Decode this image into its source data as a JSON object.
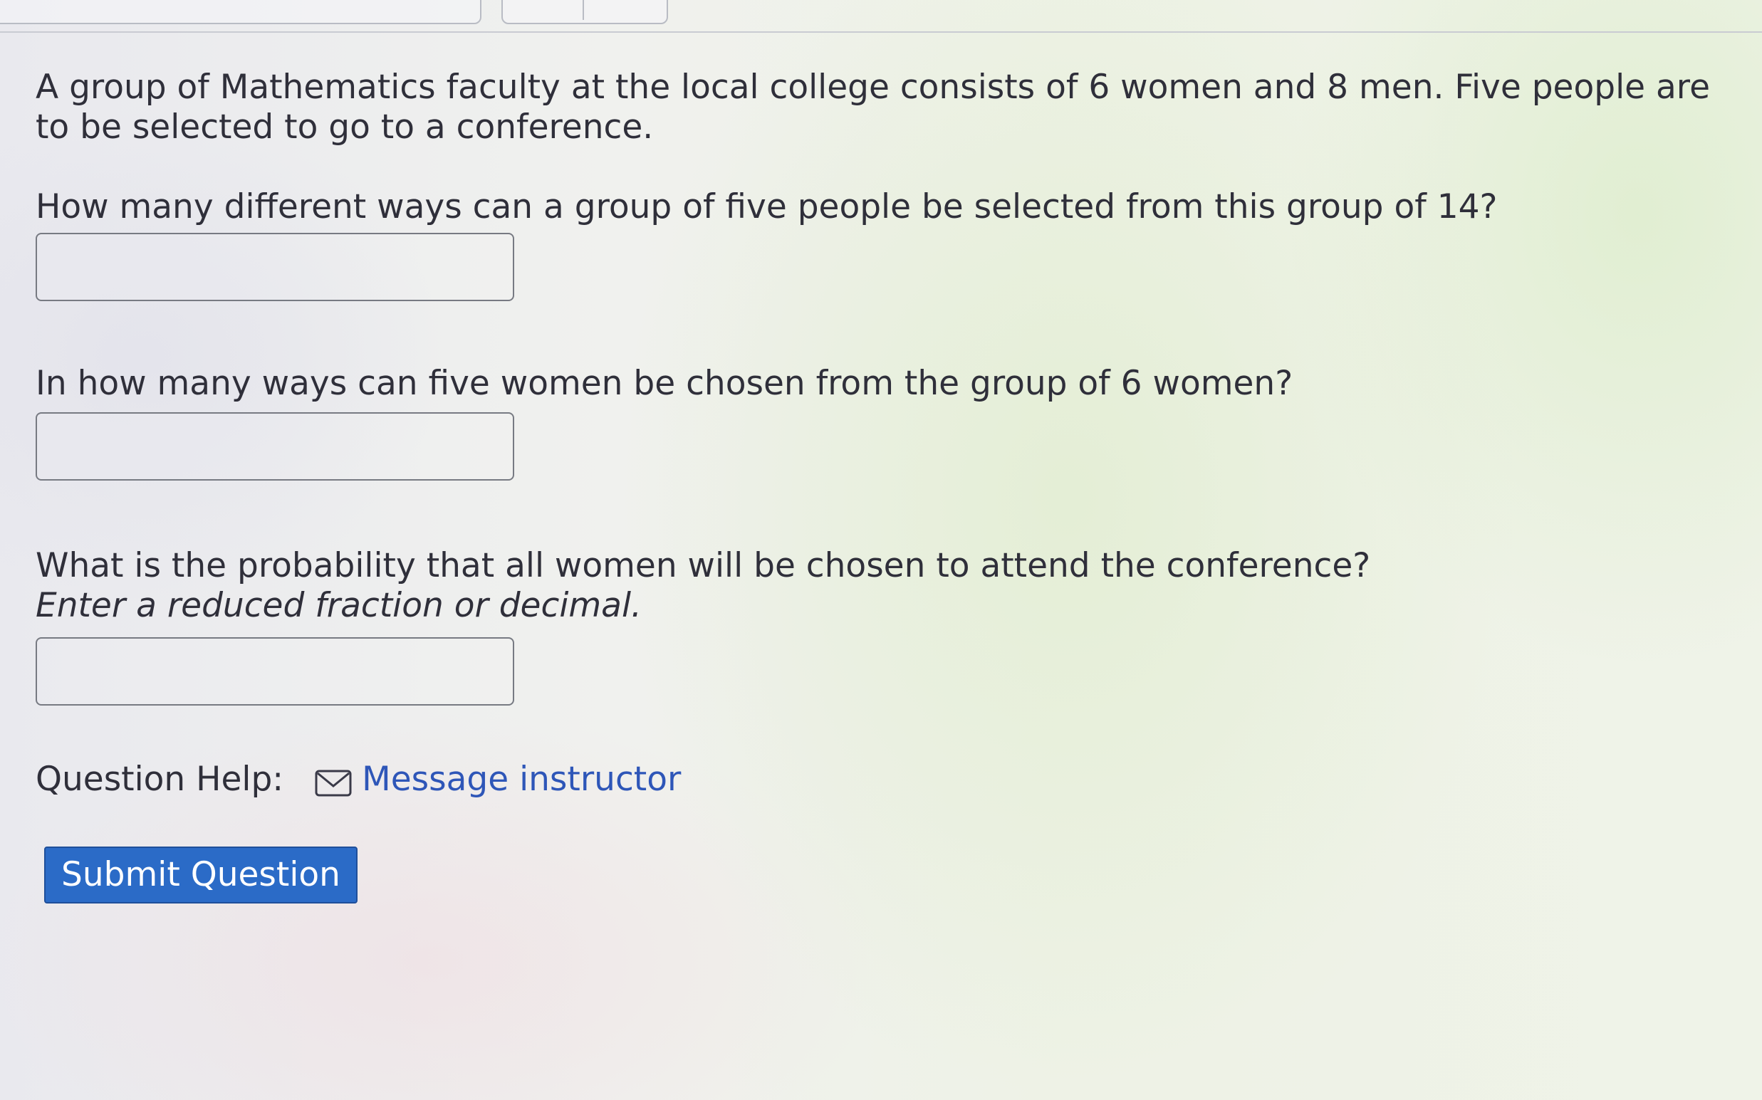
{
  "question": {
    "intro": "A group of Mathematics faculty at the local college consists of 6 women and 8 men. Five people are to be selected to go to a conference.",
    "part1": "How many different ways can a group of five people be selected from this group of 14?",
    "part1_answer": "",
    "part2": "In how many ways can five women be chosen from the group of 6 women?",
    "part2_answer": "",
    "part3": "What is the probability that all women will be chosen to attend the conference?",
    "part3_hint": "Enter a reduced fraction or decimal.",
    "part3_answer": ""
  },
  "help": {
    "label": "Question Help:",
    "icon": "mail-icon",
    "link_label": "Message instructor"
  },
  "submit_label": "Submit Question",
  "colors": {
    "link": "#2e56b8",
    "button": "#2b6bc7"
  }
}
